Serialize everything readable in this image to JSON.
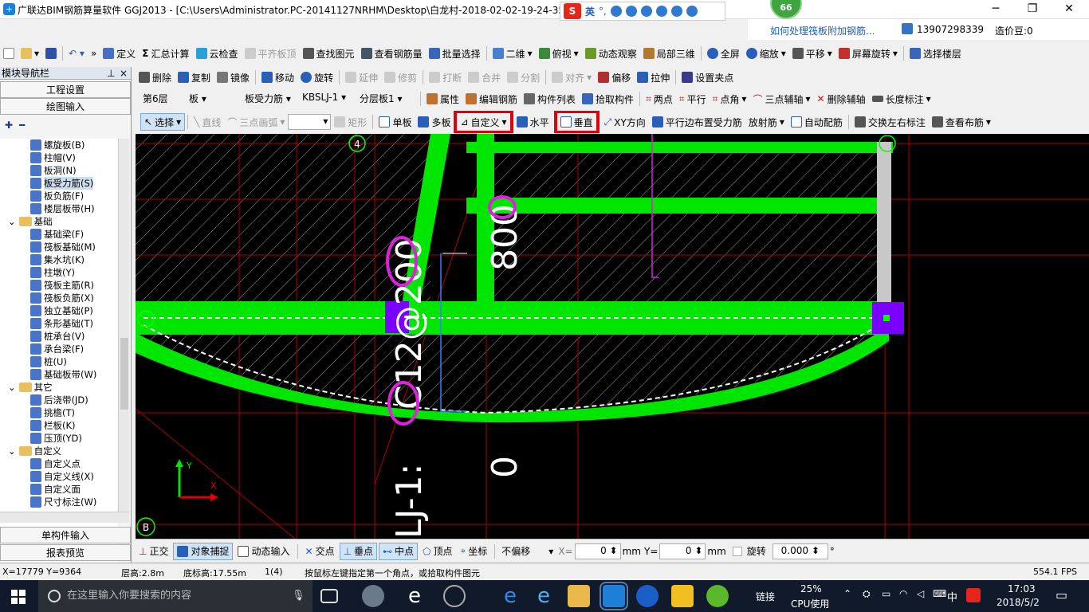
{
  "titlebar": {
    "title": "广联达BIM钢筋算量软件 GGJ2013 - [C:\\Users\\Administrator.PC-20141127NRHM\\Desktop\\白龙村-2018-02-02-19-24-35",
    "ime_label": "英",
    "notify_count": "66",
    "ad_text": "如何处理筏板附加钢筋...",
    "phone": "13907298339",
    "coins": "造价豆:0",
    "minimize": "─",
    "maximize": "❐",
    "close": "✕"
  },
  "toolbar1": {
    "items": [
      "定义",
      "汇总计算",
      "云检查",
      "平齐板顶",
      "查找图元",
      "查看钢筋量",
      "批量选择"
    ],
    "view_items": [
      "二维",
      "俯视",
      "动态观察",
      "局部三维",
      "全屏",
      "缩放",
      "平移",
      "屏幕旋转",
      "选择楼层"
    ]
  },
  "toolbar2": {
    "items": [
      "删除",
      "复制",
      "镜像",
      "移动",
      "旋转",
      "延伸",
      "修剪",
      "打断",
      "合并",
      "分割",
      "对齐",
      "偏移",
      "拉伸",
      "设置夹点"
    ]
  },
  "toolbar3": {
    "floor": "第6层",
    "category": "板",
    "type": "板受力筋",
    "name": "KBSLJ-1",
    "layer": "分层板1",
    "items": [
      "属性",
      "编辑钢筋",
      "构件列表",
      "拾取构件",
      "两点",
      "平行",
      "点角",
      "三点辅轴",
      "删除辅轴",
      "长度标注"
    ]
  },
  "toolbar4": {
    "select": "选择",
    "items": [
      "直线",
      "三点画弧",
      "矩形",
      "单板",
      "多板",
      "自定义",
      "水平",
      "垂直",
      "XY方向",
      "平行边布置受力筋",
      "放射筋",
      "自动配筋",
      "交换左右标注",
      "查看布筋"
    ]
  },
  "leftpanel": {
    "title": "模块导航栏",
    "pin": "⊥",
    "close": "×",
    "btn_project": "工程设置",
    "btn_draw": "绘图输入",
    "btn_single": "单构件输入",
    "btn_report": "报表预览",
    "tree": [
      {
        "label": "螺旋板(B)",
        "indent": 2
      },
      {
        "label": "柱帽(V)",
        "indent": 2
      },
      {
        "label": "板洞(N)",
        "indent": 2
      },
      {
        "label": "板受力筋(S)",
        "indent": 2,
        "selected": true
      },
      {
        "label": "板负筋(F)",
        "indent": 2
      },
      {
        "label": "楼层板带(H)",
        "indent": 2
      },
      {
        "label": "基础",
        "indent": 1,
        "folder": true
      },
      {
        "label": "基础梁(F)",
        "indent": 2
      },
      {
        "label": "筏板基础(M)",
        "indent": 2
      },
      {
        "label": "集水坑(K)",
        "indent": 2
      },
      {
        "label": "柱墩(Y)",
        "indent": 2
      },
      {
        "label": "筏板主筋(R)",
        "indent": 2
      },
      {
        "label": "筏板负筋(X)",
        "indent": 2
      },
      {
        "label": "独立基础(P)",
        "indent": 2
      },
      {
        "label": "条形基础(T)",
        "indent": 2
      },
      {
        "label": "桩承台(V)",
        "indent": 2
      },
      {
        "label": "承台梁(F)",
        "indent": 2
      },
      {
        "label": "桩(U)",
        "indent": 2
      },
      {
        "label": "基础板带(W)",
        "indent": 2
      },
      {
        "label": "其它",
        "indent": 1,
        "folder": true
      },
      {
        "label": "后浇带(JD)",
        "indent": 2
      },
      {
        "label": "挑檐(T)",
        "indent": 2
      },
      {
        "label": "栏板(K)",
        "indent": 2
      },
      {
        "label": "压顶(YD)",
        "indent": 2
      },
      {
        "label": "自定义",
        "indent": 1,
        "folder": true
      },
      {
        "label": "自定义点",
        "indent": 2
      },
      {
        "label": "自定义线(X)",
        "indent": 2
      },
      {
        "label": "自定义面",
        "indent": 2
      },
      {
        "label": "尺寸标注(W)",
        "indent": 2
      }
    ]
  },
  "canvas": {
    "axis_4": "4",
    "axis_b": "B",
    "rebar_label": "C12@200",
    "prefix_label": "LJ-1:",
    "dim_800": "800",
    "dim_0": "0",
    "axis_y": "Y",
    "axis_x": "X"
  },
  "statusbar": {
    "items": [
      "正交",
      "对象捕捉",
      "动态输入",
      "交点",
      "垂点",
      "中点",
      "顶点",
      "坐标"
    ],
    "offset": "不偏移",
    "x_label": "X=",
    "x_value": "0",
    "unit_mm": "mm",
    "y_label": "Y=",
    "y_value": "0",
    "rotate_label": "旋转",
    "rotate_value": "0.000",
    "degree": "°"
  },
  "infobar": {
    "coords": "X=17779 Y=9364",
    "floor_height": "层高:2.8m",
    "base_height": "底标高:17.55m",
    "count": "1(4)",
    "hint": "按鼠标左键指定第一个角点，或拾取构件图元",
    "fps": "554.1 FPS"
  },
  "taskbar": {
    "search_placeholder": "在这里输入你要搜索的内容",
    "network": "链接",
    "cpu_pct": "25%",
    "cpu_label": "CPU使用",
    "lang": "中",
    "time": "17:03",
    "date": "2018/5/2"
  },
  "colors": {
    "beam_green": "#00e600",
    "highlight_red": "#e00010",
    "magenta": "#e020e0",
    "purple_node": "#7a00ff",
    "grid_red": "#b00000"
  }
}
